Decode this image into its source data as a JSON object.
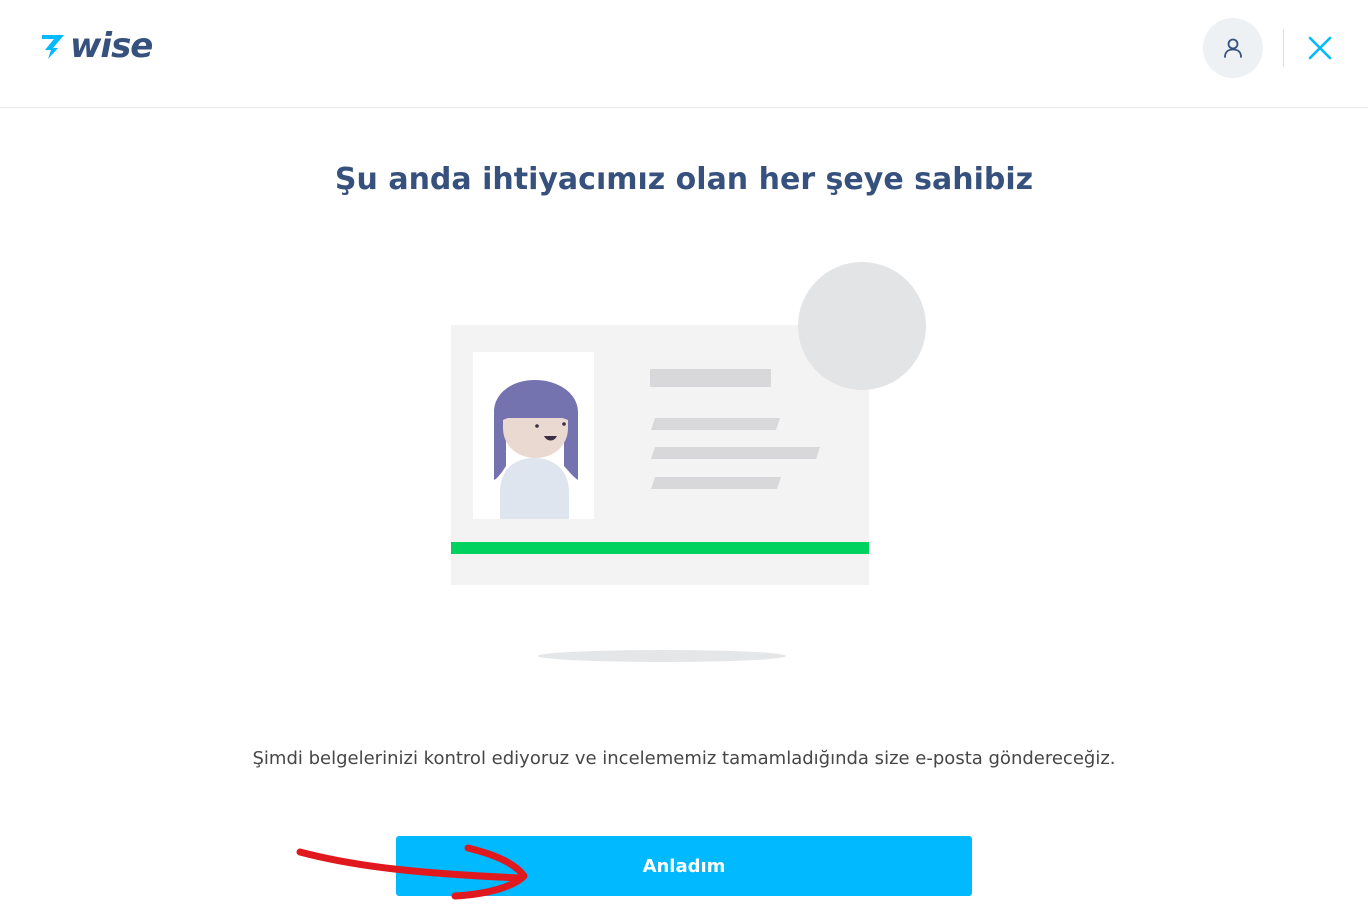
{
  "header": {
    "logo_text": "wise",
    "account_icon": "user-icon",
    "close_icon": "close-icon"
  },
  "main": {
    "title": "Şu anda ihtiyacımız olan her şeye sahibiz",
    "description": "Şimdi belgelerinizi kontrol ediyoruz ve incelememiz tamamladığında size e-posta göndereceğiz.",
    "primary_button_label": "Anladım"
  },
  "colors": {
    "brand_navy": "#37517e",
    "brand_blue": "#00b9ff",
    "accent_green": "#00d25f",
    "annotation_red": "#e0191e"
  }
}
